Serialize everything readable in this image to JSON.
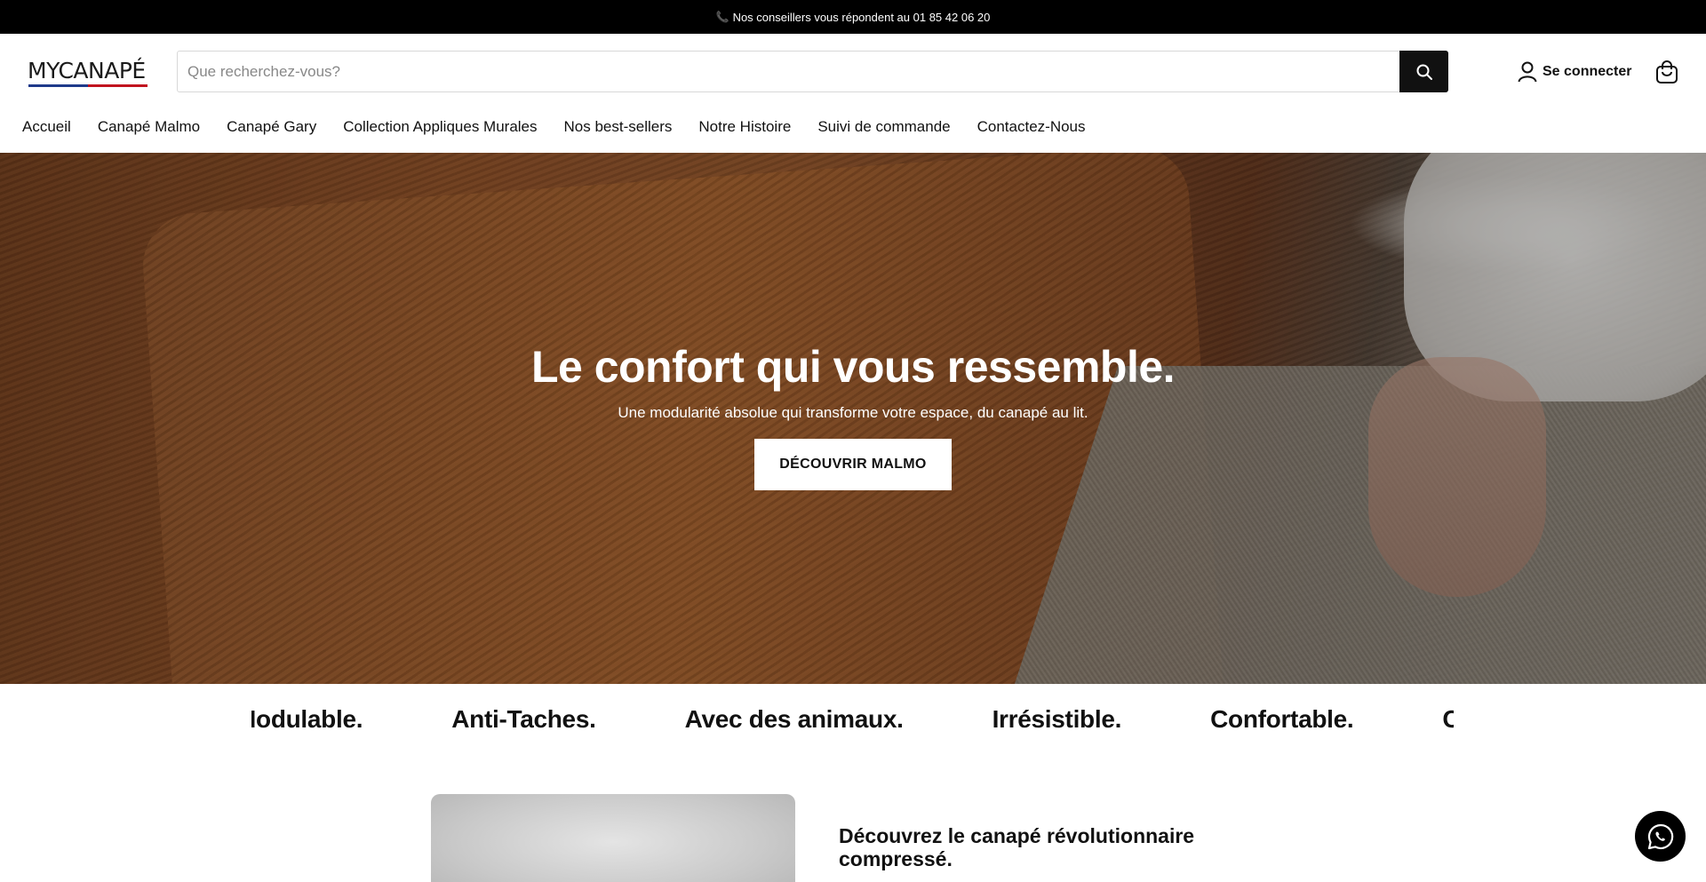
{
  "topbar": {
    "phone_icon": "📞",
    "text": "Nos conseillers vous répondent au 01 85 42 06 20"
  },
  "header": {
    "logo_text": "MYCANAPÉ",
    "search_placeholder": "Que recherchez-vous?",
    "login_label": "Se connecter"
  },
  "nav": {
    "items": [
      {
        "label": "Accueil"
      },
      {
        "label": "Canapé Malmo"
      },
      {
        "label": "Canapé Gary"
      },
      {
        "label": "Collection Appliques Murales"
      },
      {
        "label": "Nos best-sellers"
      },
      {
        "label": "Notre Histoire"
      },
      {
        "label": "Suivi de commande"
      },
      {
        "label": "Contactez-Nous"
      }
    ]
  },
  "hero": {
    "title": "Le confort qui vous ressemble.",
    "subtitle": "Une modularité absolue qui transforme votre espace, du canapé au lit.",
    "cta_label": "DÉCOUVRIR MALMO"
  },
  "marquee": {
    "items": [
      "Modulable.",
      "Anti-Taches.",
      "Avec des animaux.",
      "Irrésistible.",
      "Confortable.",
      "C"
    ]
  },
  "promo": {
    "title": "Découvrez le canapé révolutionnaire compressé."
  },
  "colors": {
    "topbar_bg": "#000000",
    "accent_blue": "#1f3a8a",
    "accent_red": "#c1121f",
    "button_dark": "#111111"
  },
  "icons": {
    "search": "search-icon",
    "user": "user-icon",
    "cart": "shopping-bag-icon",
    "chat": "whatsapp-icon",
    "phone": "phone-icon"
  }
}
